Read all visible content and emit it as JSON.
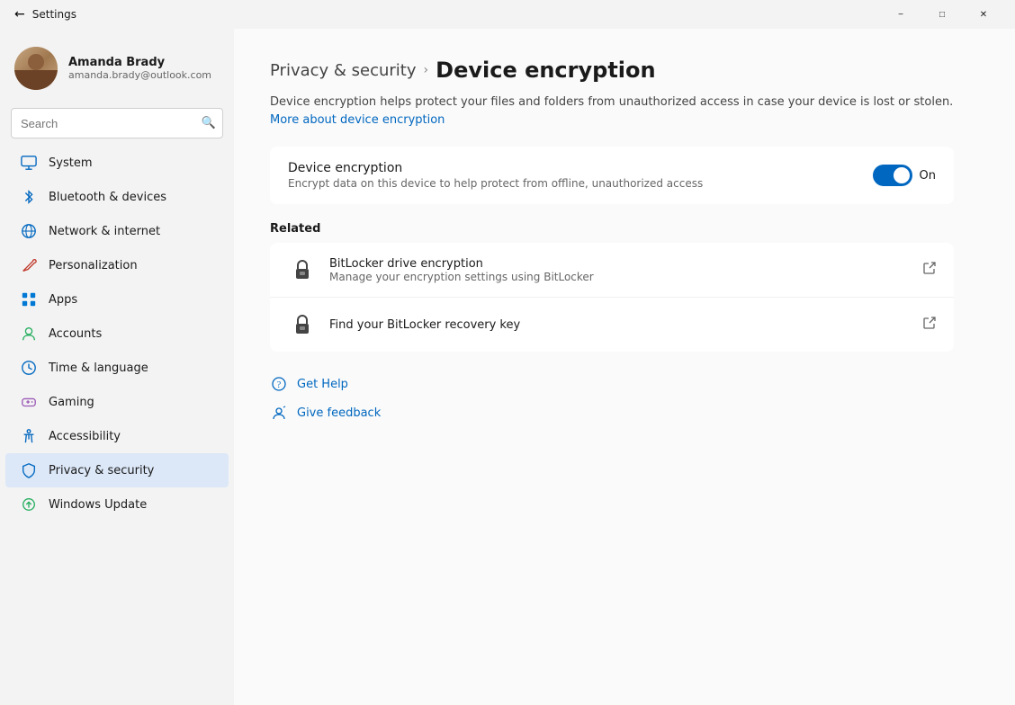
{
  "window": {
    "title": "Settings",
    "minimize_label": "−",
    "maximize_label": "□",
    "close_label": "✕"
  },
  "user": {
    "name": "Amanda Brady",
    "email": "amanda.brady@outlook.com"
  },
  "search": {
    "placeholder": "Search"
  },
  "nav": {
    "items": [
      {
        "id": "system",
        "label": "System",
        "icon": "🖥"
      },
      {
        "id": "bluetooth",
        "label": "Bluetooth & devices",
        "icon": "⚡"
      },
      {
        "id": "network",
        "label": "Network & internet",
        "icon": "🌐"
      },
      {
        "id": "personalization",
        "label": "Personalization",
        "icon": "✏"
      },
      {
        "id": "apps",
        "label": "Apps",
        "icon": "📱"
      },
      {
        "id": "accounts",
        "label": "Accounts",
        "icon": "👤"
      },
      {
        "id": "time",
        "label": "Time & language",
        "icon": "🕐"
      },
      {
        "id": "gaming",
        "label": "Gaming",
        "icon": "🎮"
      },
      {
        "id": "accessibility",
        "label": "Accessibility",
        "icon": "♿"
      },
      {
        "id": "privacy",
        "label": "Privacy & security",
        "icon": "🔒",
        "active": true
      },
      {
        "id": "update",
        "label": "Windows Update",
        "icon": "🔄"
      }
    ]
  },
  "breadcrumb": {
    "parent": "Privacy & security",
    "separator": "›",
    "current": "Device encryption"
  },
  "description": {
    "text": "Device encryption helps protect your files and folders from unauthorized access in case your device is lost or stolen.",
    "link_text": "More about device encryption"
  },
  "device_encryption": {
    "title": "Device encryption",
    "desc": "Encrypt data on this device to help protect from offline, unauthorized access",
    "toggle_state": "On",
    "toggle_on": true
  },
  "related": {
    "section_title": "Related",
    "items": [
      {
        "id": "bitlocker",
        "title": "BitLocker drive encryption",
        "desc": "Manage your encryption settings using BitLocker",
        "has_external": true
      },
      {
        "id": "recovery-key",
        "title": "Find your BitLocker recovery key",
        "desc": "",
        "has_external": true
      }
    ]
  },
  "links": [
    {
      "id": "get-help",
      "label": "Get Help"
    },
    {
      "id": "give-feedback",
      "label": "Give feedback"
    }
  ]
}
